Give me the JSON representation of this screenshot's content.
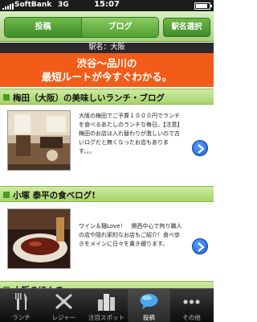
{
  "status_bar": {
    "carrier": "SoftBank",
    "network": "3G",
    "time": "15:07",
    "battery_level": 0.85
  },
  "header": {
    "segments": [
      {
        "label": "投稿",
        "active": true
      },
      {
        "label": "ブログ",
        "active": false
      }
    ],
    "name_select_label": "駅名選択"
  },
  "station_bar": {
    "text": "駅名：大阪"
  },
  "banner": {
    "line1": "渋谷～品川の",
    "line2": "最短ルートが今すぐわかる。"
  },
  "blogs": [
    {
      "title": "梅田（大阪）の美味しいランチ・ブログ",
      "description": "大阪の梅田でご予算１０００円でランチを食べるあたしのランチな毎日。【注意】梅田のお店は入れ替わりが激しいので古いログだと無くなったお店もあります。。。"
    },
    {
      "title": "小塚 泰平の食ベログ!",
      "description": "ワイン＆麺Love！　関西中心で拘り職人の店や隠れ家的なお店もご紹介！食べ歩きをメインに日々を書き綴ります。"
    },
    {
      "title": "大阪のほんま"
    }
  ],
  "tabbar": {
    "tabs": [
      {
        "label": "ランチ",
        "icon": "fork-knife-icon",
        "active": false
      },
      {
        "label": "レジャー",
        "icon": "cross-icon",
        "active": false
      },
      {
        "label": "注目スポット",
        "icon": "buildings-icon",
        "active": false
      },
      {
        "label": "投稿",
        "icon": "speech-bubble-icon",
        "active": true
      },
      {
        "label": "その他",
        "icon": "more-icon",
        "active": false
      }
    ]
  },
  "colors": {
    "header_green": "#a9d27e",
    "banner_orange": "#f25c19",
    "accent_blue": "#1a5fd6"
  }
}
